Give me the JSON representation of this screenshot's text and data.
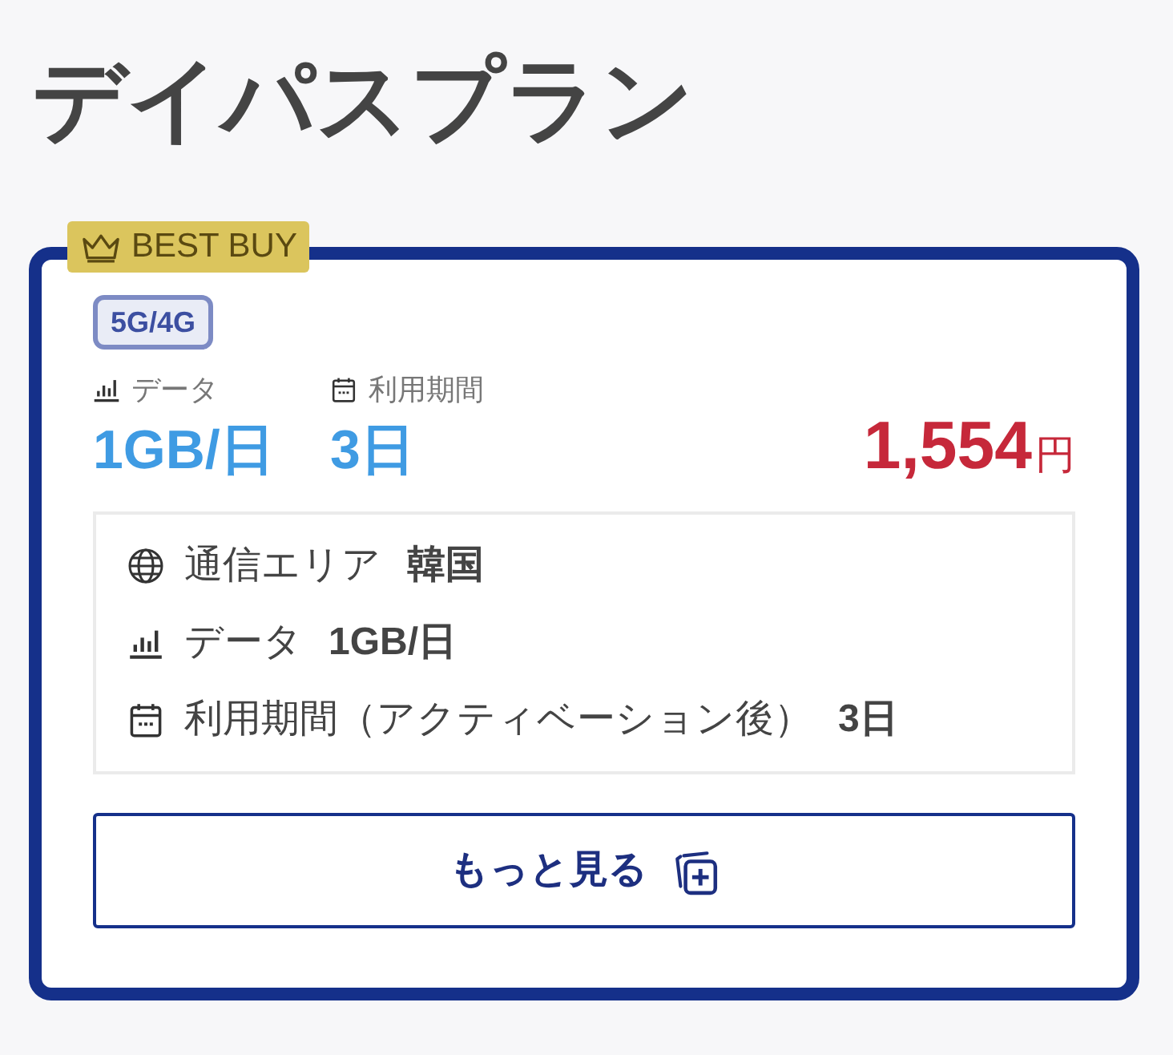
{
  "page": {
    "title": "デイパスプラン"
  },
  "plan_card": {
    "badge": {
      "label": "BEST BUY"
    },
    "network_tag": "5G/4G",
    "specs": [
      {
        "kind": "data",
        "label": "データ",
        "value": "1GB/日"
      },
      {
        "kind": "period",
        "label": "利用期間",
        "value": "3日"
      }
    ],
    "price": {
      "amount": "1,554",
      "unit": "円"
    },
    "details": [
      {
        "kind": "area",
        "label": "通信エリア",
        "value": "韓国"
      },
      {
        "kind": "data",
        "label": "データ",
        "value": "1GB/日"
      },
      {
        "kind": "period",
        "label": "利用期間（アクティベーション後）",
        "value": "3日"
      }
    ],
    "more_button": {
      "label": "もっと見る"
    }
  }
}
